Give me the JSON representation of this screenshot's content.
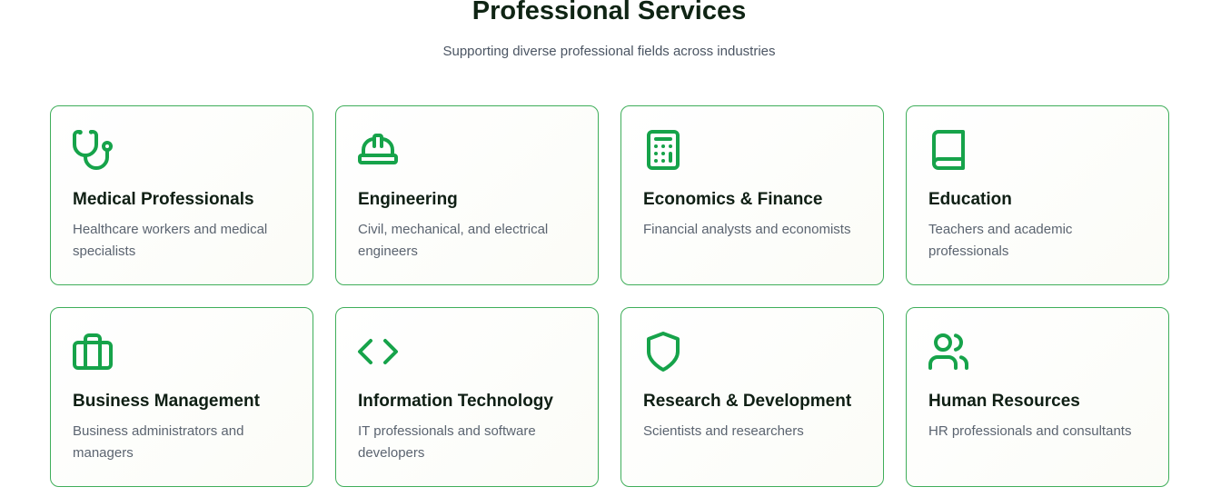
{
  "header": {
    "title": "Professional Services",
    "subtitle": "Supporting diverse professional fields across industries"
  },
  "colors": {
    "accent": "#16a34a",
    "card_border": "#3fae5a",
    "title_text": "#0f2414",
    "body_text": "#5b6470"
  },
  "cards": [
    {
      "icon": "stethoscope-icon",
      "title": "Medical Professionals",
      "description": "Healthcare workers and medical specialists"
    },
    {
      "icon": "hard-hat-icon",
      "title": "Engineering",
      "description": "Civil, mechanical, and electrical engineers"
    },
    {
      "icon": "calculator-icon",
      "title": "Economics & Finance",
      "description": "Financial analysts and economists"
    },
    {
      "icon": "book-icon",
      "title": "Education",
      "description": "Teachers and academic professionals"
    },
    {
      "icon": "briefcase-icon",
      "title": "Business Management",
      "description": "Business administrators and managers"
    },
    {
      "icon": "code-icon",
      "title": "Information Technology",
      "description": "IT professionals and software developers"
    },
    {
      "icon": "shield-icon",
      "title": "Research & Development",
      "description": "Scientists and researchers"
    },
    {
      "icon": "users-icon",
      "title": "Human Resources",
      "description": "HR professionals and consultants"
    }
  ]
}
